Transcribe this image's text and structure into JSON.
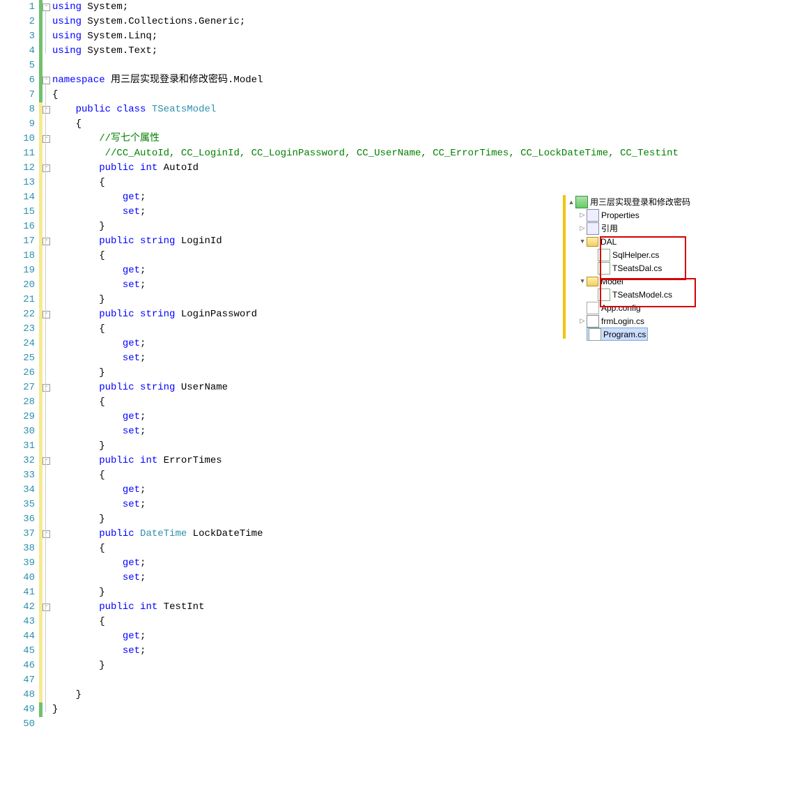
{
  "code": {
    "lines": [
      {
        "n": 1,
        "m": "green",
        "out": "minus",
        "t": [
          [
            "kw",
            "using"
          ],
          [
            "",
            " System;"
          ]
        ]
      },
      {
        "n": 2,
        "m": "green",
        "out": "line",
        "t": [
          [
            "kw",
            "using"
          ],
          [
            "",
            " System.Collections.Generic;"
          ]
        ]
      },
      {
        "n": 3,
        "m": "green",
        "out": "line",
        "t": [
          [
            "kw",
            "using"
          ],
          [
            "",
            " System.Linq;"
          ]
        ]
      },
      {
        "n": 4,
        "m": "green",
        "out": "end",
        "t": [
          [
            "kw",
            "using"
          ],
          [
            "",
            " System.Text;"
          ]
        ]
      },
      {
        "n": 5,
        "m": "green",
        "t": [
          [
            "",
            ""
          ]
        ]
      },
      {
        "n": 6,
        "m": "green",
        "out": "minus",
        "t": [
          [
            "kw",
            "namespace"
          ],
          [
            "",
            " 用三层实现登录和修改密码.Model"
          ]
        ]
      },
      {
        "n": 7,
        "m": "green",
        "out": "line",
        "t": [
          [
            "",
            "{"
          ]
        ]
      },
      {
        "n": 8,
        "m": "yellow",
        "out": "minus",
        "t": [
          [
            "",
            "    "
          ],
          [
            "kw",
            "public"
          ],
          [
            "",
            " "
          ],
          [
            "kw",
            "class"
          ],
          [
            "",
            " "
          ],
          [
            "type",
            "TSeatsModel"
          ]
        ]
      },
      {
        "n": 9,
        "m": "yellow",
        "out": "line",
        "t": [
          [
            "",
            "    {"
          ]
        ]
      },
      {
        "n": 10,
        "m": "yellow",
        "out": "minus",
        "t": [
          [
            "",
            "        "
          ],
          [
            "cm",
            "//写七个属性"
          ]
        ]
      },
      {
        "n": 11,
        "m": "yellow",
        "out": "line",
        "t": [
          [
            "",
            "         "
          ],
          [
            "cm",
            "//CC_AutoId, CC_LoginId, CC_LoginPassword, CC_UserName, CC_ErrorTimes, CC_LockDateTime, CC_Testint"
          ]
        ]
      },
      {
        "n": 12,
        "m": "yellow",
        "out": "minus",
        "t": [
          [
            "",
            "        "
          ],
          [
            "kw",
            "public"
          ],
          [
            "",
            " "
          ],
          [
            "kw",
            "int"
          ],
          [
            "",
            " AutoId"
          ]
        ]
      },
      {
        "n": 13,
        "m": "yellow",
        "out": "line",
        "t": [
          [
            "",
            "        {"
          ]
        ]
      },
      {
        "n": 14,
        "m": "yellow",
        "out": "line",
        "t": [
          [
            "",
            "            "
          ],
          [
            "kw",
            "get"
          ],
          [
            "",
            ";"
          ]
        ]
      },
      {
        "n": 15,
        "m": "yellow",
        "out": "line",
        "t": [
          [
            "",
            "            "
          ],
          [
            "kw",
            "set"
          ],
          [
            "",
            ";"
          ]
        ]
      },
      {
        "n": 16,
        "m": "yellow",
        "out": "line",
        "t": [
          [
            "",
            "        }"
          ]
        ]
      },
      {
        "n": 17,
        "m": "yellow",
        "out": "minus",
        "t": [
          [
            "",
            "        "
          ],
          [
            "kw",
            "public"
          ],
          [
            "",
            " "
          ],
          [
            "kw",
            "string"
          ],
          [
            "",
            " LoginId"
          ]
        ]
      },
      {
        "n": 18,
        "m": "yellow",
        "out": "line",
        "t": [
          [
            "",
            "        {"
          ]
        ]
      },
      {
        "n": 19,
        "m": "yellow",
        "out": "line",
        "t": [
          [
            "",
            "            "
          ],
          [
            "kw",
            "get"
          ],
          [
            "",
            ";"
          ]
        ]
      },
      {
        "n": 20,
        "m": "yellow",
        "out": "line",
        "t": [
          [
            "",
            "            "
          ],
          [
            "kw",
            "set"
          ],
          [
            "",
            ";"
          ]
        ]
      },
      {
        "n": 21,
        "m": "yellow",
        "out": "line",
        "t": [
          [
            "",
            "        }"
          ]
        ]
      },
      {
        "n": 22,
        "m": "yellow",
        "out": "minus",
        "t": [
          [
            "",
            "        "
          ],
          [
            "kw",
            "public"
          ],
          [
            "",
            " "
          ],
          [
            "kw",
            "string"
          ],
          [
            "",
            " LoginPassword"
          ]
        ]
      },
      {
        "n": 23,
        "m": "yellow",
        "out": "line",
        "t": [
          [
            "",
            "        {"
          ]
        ]
      },
      {
        "n": 24,
        "m": "yellow",
        "out": "line",
        "t": [
          [
            "",
            "            "
          ],
          [
            "kw",
            "get"
          ],
          [
            "",
            ";"
          ]
        ]
      },
      {
        "n": 25,
        "m": "yellow",
        "out": "line",
        "t": [
          [
            "",
            "            "
          ],
          [
            "kw",
            "set"
          ],
          [
            "",
            ";"
          ]
        ]
      },
      {
        "n": 26,
        "m": "yellow",
        "out": "line",
        "t": [
          [
            "",
            "        }"
          ]
        ]
      },
      {
        "n": 27,
        "m": "yellow",
        "out": "minus",
        "t": [
          [
            "",
            "        "
          ],
          [
            "kw",
            "public"
          ],
          [
            "",
            " "
          ],
          [
            "kw",
            "string"
          ],
          [
            "",
            " UserName"
          ]
        ]
      },
      {
        "n": 28,
        "m": "yellow",
        "out": "line",
        "t": [
          [
            "",
            "        {"
          ]
        ]
      },
      {
        "n": 29,
        "m": "yellow",
        "out": "line",
        "t": [
          [
            "",
            "            "
          ],
          [
            "kw",
            "get"
          ],
          [
            "",
            ";"
          ]
        ]
      },
      {
        "n": 30,
        "m": "yellow",
        "out": "line",
        "t": [
          [
            "",
            "            "
          ],
          [
            "kw",
            "set"
          ],
          [
            "",
            ";"
          ]
        ]
      },
      {
        "n": 31,
        "m": "yellow",
        "out": "line",
        "t": [
          [
            "",
            "        }"
          ]
        ]
      },
      {
        "n": 32,
        "m": "yellow",
        "out": "minus",
        "t": [
          [
            "",
            "        "
          ],
          [
            "kw",
            "public"
          ],
          [
            "",
            " "
          ],
          [
            "kw",
            "int"
          ],
          [
            "",
            " ErrorTimes"
          ]
        ]
      },
      {
        "n": 33,
        "m": "yellow",
        "out": "line",
        "t": [
          [
            "",
            "        {"
          ]
        ]
      },
      {
        "n": 34,
        "m": "yellow",
        "out": "line",
        "t": [
          [
            "",
            "            "
          ],
          [
            "kw",
            "get"
          ],
          [
            "",
            ";"
          ]
        ]
      },
      {
        "n": 35,
        "m": "yellow",
        "out": "line",
        "t": [
          [
            "",
            "            "
          ],
          [
            "kw",
            "set"
          ],
          [
            "",
            ";"
          ]
        ]
      },
      {
        "n": 36,
        "m": "yellow",
        "out": "line",
        "t": [
          [
            "",
            "        }"
          ]
        ]
      },
      {
        "n": 37,
        "m": "yellow",
        "out": "minus",
        "t": [
          [
            "",
            "        "
          ],
          [
            "kw",
            "public"
          ],
          [
            "",
            " "
          ],
          [
            "type",
            "DateTime"
          ],
          [
            "",
            " LockDateTime"
          ]
        ]
      },
      {
        "n": 38,
        "m": "yellow",
        "out": "line",
        "t": [
          [
            "",
            "        {"
          ]
        ]
      },
      {
        "n": 39,
        "m": "yellow",
        "out": "line",
        "t": [
          [
            "",
            "            "
          ],
          [
            "kw",
            "get"
          ],
          [
            "",
            ";"
          ]
        ]
      },
      {
        "n": 40,
        "m": "yellow",
        "out": "line",
        "t": [
          [
            "",
            "            "
          ],
          [
            "kw",
            "set"
          ],
          [
            "",
            ";"
          ]
        ]
      },
      {
        "n": 41,
        "m": "yellow",
        "out": "line",
        "t": [
          [
            "",
            "        }"
          ]
        ]
      },
      {
        "n": 42,
        "m": "yellow",
        "out": "minus",
        "t": [
          [
            "",
            "        "
          ],
          [
            "kw",
            "public"
          ],
          [
            "",
            " "
          ],
          [
            "kw",
            "int"
          ],
          [
            "",
            " TestInt"
          ]
        ]
      },
      {
        "n": 43,
        "m": "yellow",
        "out": "line",
        "t": [
          [
            "",
            "        {"
          ]
        ]
      },
      {
        "n": 44,
        "m": "yellow",
        "out": "line",
        "t": [
          [
            "",
            "            "
          ],
          [
            "kw",
            "get"
          ],
          [
            "",
            ";"
          ]
        ]
      },
      {
        "n": 45,
        "m": "yellow",
        "out": "line",
        "t": [
          [
            "",
            "            "
          ],
          [
            "kw",
            "set"
          ],
          [
            "",
            ";"
          ]
        ]
      },
      {
        "n": 46,
        "m": "yellow",
        "out": "line",
        "t": [
          [
            "",
            "        }"
          ]
        ]
      },
      {
        "n": 47,
        "m": "yellow",
        "out": "line",
        "t": [
          [
            "",
            ""
          ]
        ]
      },
      {
        "n": 48,
        "m": "yellow",
        "out": "line",
        "t": [
          [
            "",
            "    }"
          ]
        ]
      },
      {
        "n": 49,
        "m": "green",
        "out": "end",
        "t": [
          [
            "",
            "}"
          ]
        ]
      },
      {
        "n": 50,
        "t": [
          [
            "",
            ""
          ]
        ]
      }
    ]
  },
  "tree": {
    "project": "用三层实现登录和修改密码",
    "nodes": [
      {
        "label": "Properties",
        "icon": "ref",
        "indent": 1,
        "arrow": "right"
      },
      {
        "label": "引用",
        "icon": "ref",
        "indent": 1,
        "arrow": "right"
      },
      {
        "label": "DAL",
        "icon": "folder-open",
        "indent": 1,
        "arrow": "down"
      },
      {
        "label": "SqlHelper.cs",
        "icon": "cs",
        "indent": 2,
        "arrow": ""
      },
      {
        "label": "TSeatsDal.cs",
        "icon": "cs",
        "indent": 2,
        "arrow": ""
      },
      {
        "label": "Model",
        "icon": "folder-open",
        "indent": 1,
        "arrow": "down"
      },
      {
        "label": "TSeatsModel.cs",
        "icon": "cs",
        "indent": 2,
        "arrow": "",
        "selectedLike": true
      },
      {
        "label": "App.config",
        "icon": "config",
        "indent": 1,
        "arrow": ""
      },
      {
        "label": "frmLogin.cs",
        "icon": "form",
        "indent": 1,
        "arrow": "right"
      },
      {
        "label": "Program.cs",
        "icon": "cs",
        "indent": 1,
        "arrow": "",
        "selected": true
      }
    ]
  }
}
